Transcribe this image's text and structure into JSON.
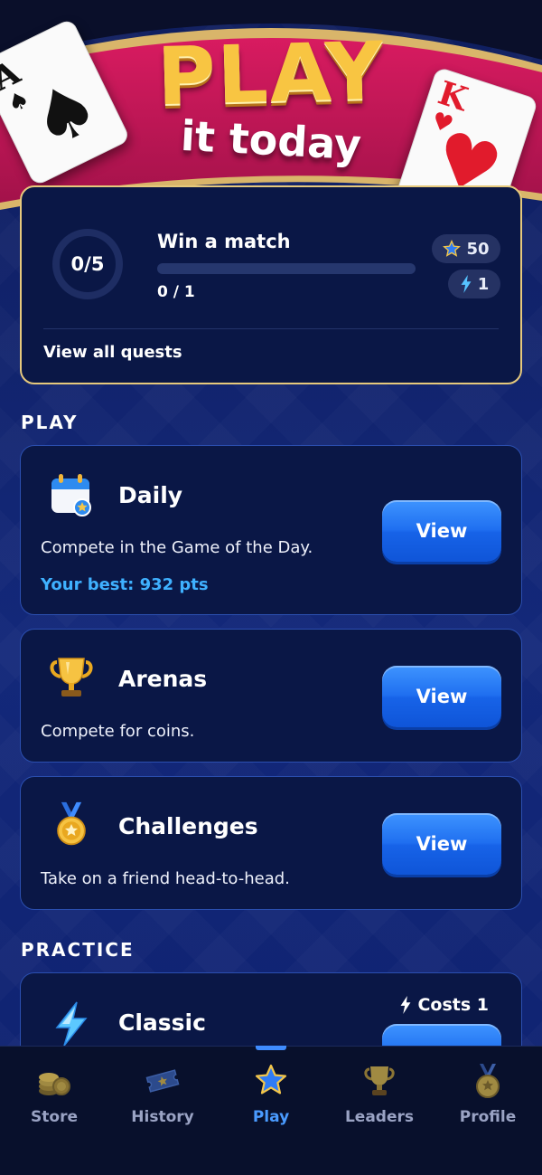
{
  "banner": {
    "title": "PLAY",
    "subtitle": "it today",
    "ace_rank": "A",
    "king_rank": "K"
  },
  "quest": {
    "ring_text": "0/5",
    "title": "Win a match",
    "progress": 0,
    "count_text": "0 / 1",
    "reward_stars": "50",
    "reward_energy": "1",
    "view_all": "View all quests"
  },
  "sections": {
    "play": "PLAY",
    "practice": "PRACTICE"
  },
  "modes": {
    "daily": {
      "name": "Daily",
      "description": "Compete in the Game of the Day.",
      "best": "Your best: 932 pts",
      "button": "View"
    },
    "arenas": {
      "name": "Arenas",
      "description": "Compete for coins.",
      "button": "View"
    },
    "challenges": {
      "name": "Challenges",
      "description": "Take on a friend head-to-head.",
      "button": "View"
    },
    "classic": {
      "name": "Classic",
      "cost": "Costs 1"
    }
  },
  "nav": {
    "items": [
      {
        "label": "Store",
        "icon": "coins-icon"
      },
      {
        "label": "History",
        "icon": "ticket-icon"
      },
      {
        "label": "Play",
        "icon": "star-icon",
        "active": true
      },
      {
        "label": "Leaders",
        "icon": "trophy-icon"
      },
      {
        "label": "Profile",
        "icon": "medal-icon"
      }
    ]
  },
  "colors": {
    "accent": "#3f8cff",
    "gold_border": "#e6c97c",
    "best_text": "#3fb1ff",
    "banner_red": "#c2185b"
  }
}
